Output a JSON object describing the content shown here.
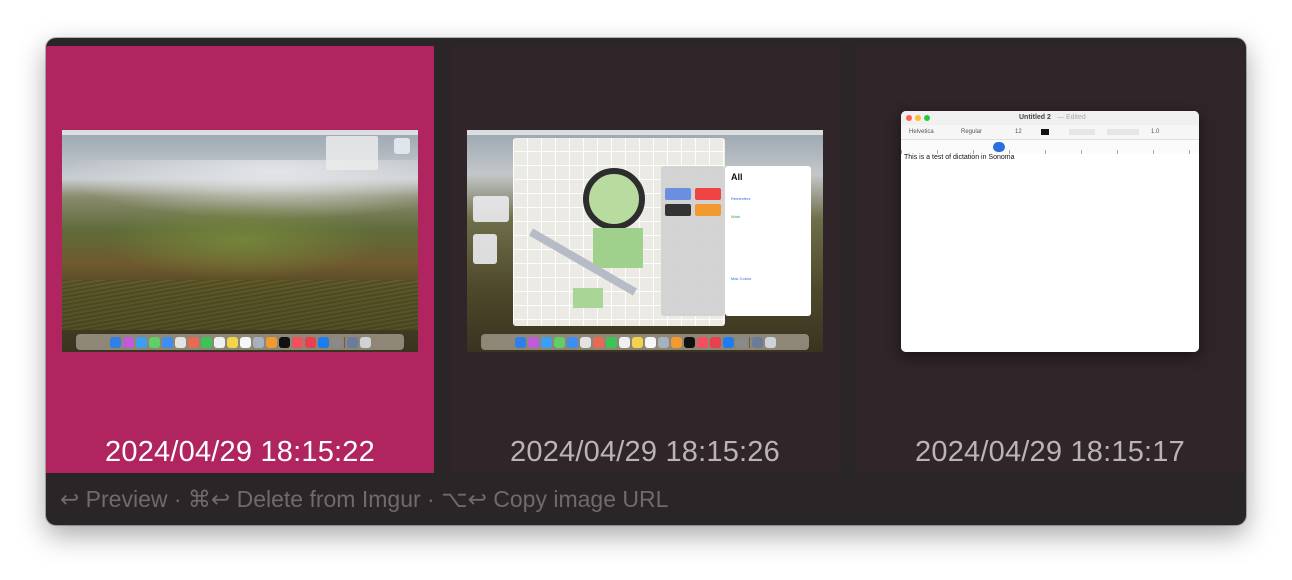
{
  "items": [
    {
      "date": "2024/04/29 18:15:22",
      "selected": true,
      "kind": "finder-desktop"
    },
    {
      "date": "2024/04/29 18:15:26",
      "selected": false,
      "kind": "reminders-desktop"
    },
    {
      "date": "2024/04/29 18:15:17",
      "selected": false,
      "kind": "textedit-window"
    }
  ],
  "textedit": {
    "window_title": "Untitled 2",
    "edited_label": "— Edited",
    "font_name": "Helvetica",
    "font_style": "Regular",
    "font_size": "12",
    "line_spacing": "1.0",
    "body_text": "This is a test of dictation in Sonoma"
  },
  "reminders": {
    "list_title": "All",
    "section_reminders": "Reminders",
    "section_work": "Work",
    "section_colors": "Mac Colors"
  },
  "footer": {
    "preview": "↩ Preview",
    "delete": "⌘↩ Delete from Imgur",
    "copy": "⌥↩ Copy image URL",
    "separator": "·"
  },
  "colors": {
    "selected_tile": "#b0245f",
    "tile": "#302529",
    "window": "#2a2527"
  }
}
